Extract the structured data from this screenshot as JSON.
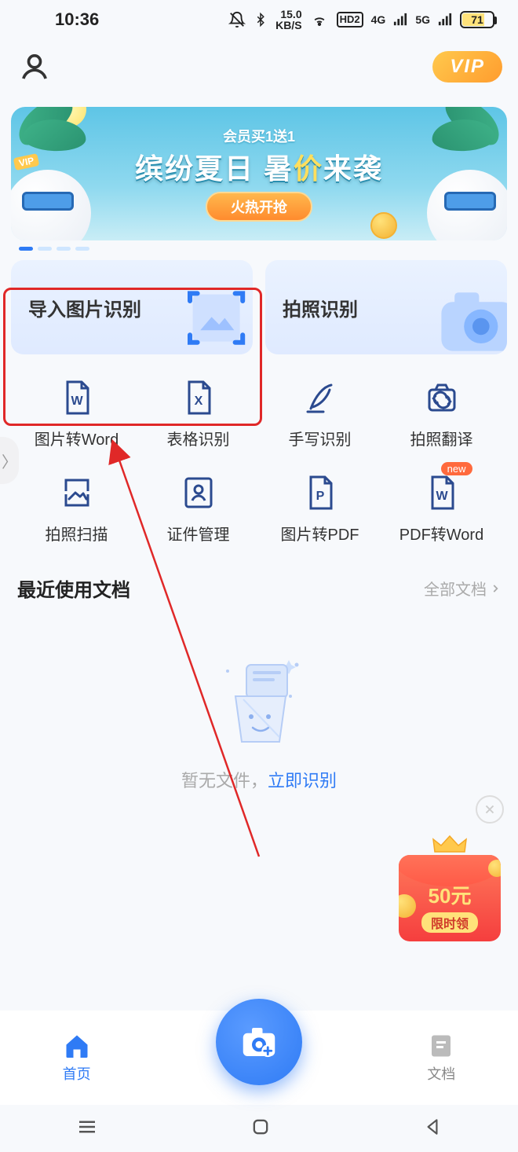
{
  "status": {
    "time": "10:36",
    "kbps_top": "15.0",
    "kbps_bottom": "KB/S",
    "hd": "HD2",
    "net1": "4G",
    "net2": "5G",
    "battery": "71"
  },
  "header": {
    "vip": "VIP"
  },
  "promo": {
    "sub": "会员买1送1",
    "title_left": "缤纷夏日 暑",
    "title_accent": "价",
    "title_right": "来袭",
    "button": "火热开抢",
    "vip_tag": "VIP"
  },
  "main_cards": {
    "import": "导入图片识别",
    "camera": "拍照识别"
  },
  "grid": [
    {
      "label": "图片转Word"
    },
    {
      "label": "表格识别"
    },
    {
      "label": "手写识别"
    },
    {
      "label": "拍照翻译"
    },
    {
      "label": "拍照扫描"
    },
    {
      "label": "证件管理"
    },
    {
      "label": "图片转PDF"
    },
    {
      "label": "PDF转Word"
    }
  ],
  "grid_new_tag": "new",
  "side_tab": "〉",
  "section": {
    "title": "最近使用文档",
    "more": "全部文档"
  },
  "empty": {
    "prefix": "暂无文件，",
    "link": "立即识别"
  },
  "red_packet": {
    "amount": "50元",
    "tag": "限时领"
  },
  "nav": {
    "home": "首页",
    "docs": "文档"
  }
}
